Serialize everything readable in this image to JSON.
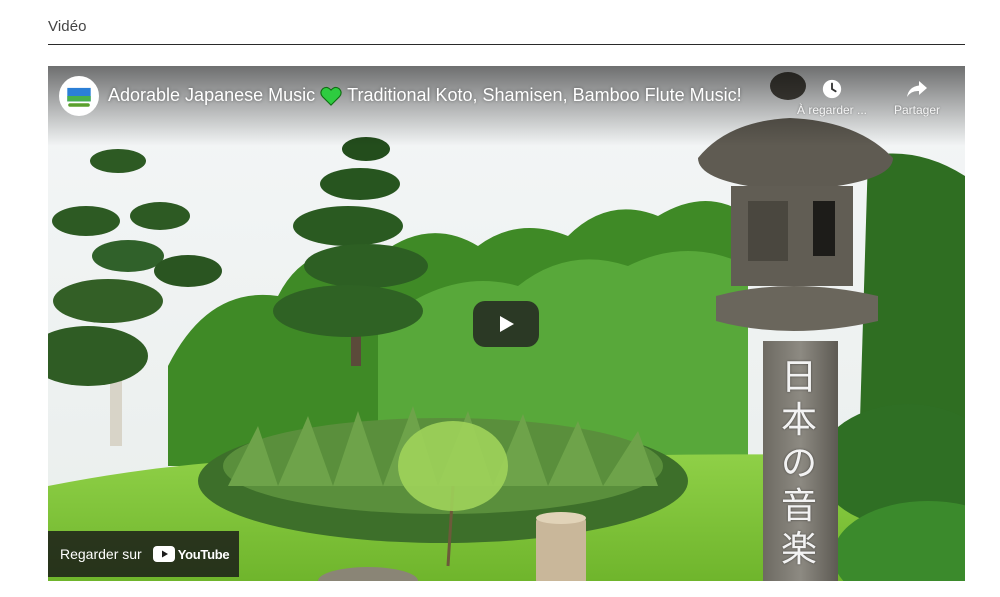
{
  "section": {
    "title": "Vidéo"
  },
  "video": {
    "title_part1": "Adorable Japanese Music",
    "title_part2": "Traditional Koto, Shamisen, Bamboo Flute Music!",
    "heart_color": "#2ecc40",
    "watch_later_label": "À regarder ...",
    "share_label": "Partager",
    "watch_on_label": "Regarder sur",
    "youtube_label": "YouTube",
    "youtube_red": "#ff0000",
    "pillar_chars": [
      "日",
      "本",
      "の",
      "音",
      "楽"
    ]
  },
  "icons": {
    "avatar": "channel-avatar",
    "clock": "clock-icon",
    "share": "share-arrow-icon",
    "play": "play-icon",
    "youtube": "youtube-logo-icon"
  }
}
